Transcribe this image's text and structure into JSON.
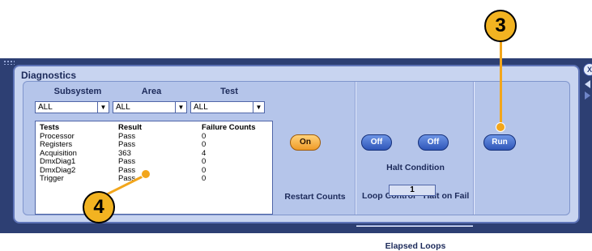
{
  "panel": {
    "title": "Diagnostics"
  },
  "filters": {
    "subsystem": {
      "label": "Subsystem",
      "value": "ALL"
    },
    "area": {
      "label": "Area",
      "value": "ALL"
    },
    "test": {
      "label": "Test",
      "value": "ALL"
    }
  },
  "results": {
    "headers": [
      "Tests",
      "Result",
      "Failure Counts"
    ],
    "rows": [
      [
        "Processor",
        "Pass",
        "0"
      ],
      [
        "Registers",
        "Pass",
        "0"
      ],
      [
        "Acquisition",
        "363",
        "4"
      ],
      [
        "DmxDiag1",
        "Pass",
        "0"
      ],
      [
        "DmxDiag2",
        "Pass",
        "0"
      ],
      [
        "Trigger",
        "Pass",
        "0"
      ]
    ]
  },
  "restart_counts": {
    "label": "Restart Counts",
    "button": "On"
  },
  "halt_condition": {
    "title": "Halt Condition",
    "loop_control": {
      "label": "Loop Control",
      "button": "Off"
    },
    "halt_on_fail": {
      "label": "Halt on Fail",
      "button": "Off"
    }
  },
  "elapsed_loops": {
    "label": "Elapsed Loops",
    "value": "1"
  },
  "run_button": {
    "label": "Run"
  },
  "side_controls": {
    "close": "X"
  },
  "callouts": [
    {
      "number": "3"
    },
    {
      "number": "4"
    }
  ],
  "colors": {
    "frame": "#2d3f73",
    "panel": "#c8d4f0",
    "accent_orange": "#ef9b28",
    "button_blue": "#2f56b8",
    "callout": "#f2b321"
  }
}
